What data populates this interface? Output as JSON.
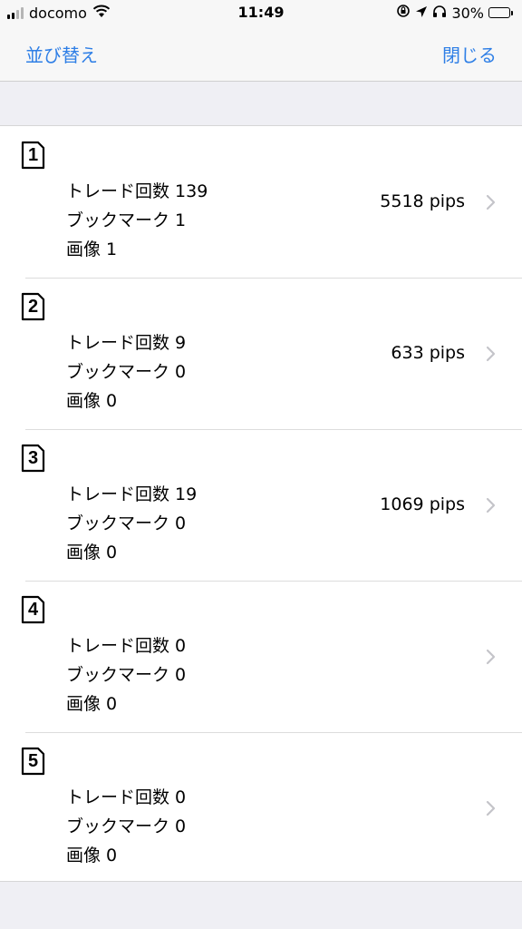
{
  "status_bar": {
    "carrier": "docomo",
    "time": "11:49",
    "battery_percent": "30%",
    "battery_level": 0.3,
    "signal_bars": 4,
    "signal_bars_active": 2,
    "icons": [
      "signal-icon",
      "wifi-icon",
      "orientation-lock-icon",
      "location-icon",
      "headphones-icon",
      "battery-icon"
    ]
  },
  "nav": {
    "left_label": "並び替え",
    "right_label": "閉じる",
    "accent_color": "#2f7fe6"
  },
  "rows": [
    {
      "number": "1",
      "trades": "トレード回数 139",
      "bookmarks": "ブックマーク 1",
      "images": "画像 1",
      "pips": "5518 pips"
    },
    {
      "number": "2",
      "trades": "トレード回数 9",
      "bookmarks": "ブックマーク 0",
      "images": "画像 0",
      "pips": "633 pips"
    },
    {
      "number": "3",
      "trades": "トレード回数 19",
      "bookmarks": "ブックマーク 0",
      "images": "画像 0",
      "pips": "1069 pips"
    },
    {
      "number": "4",
      "trades": "トレード回数 0",
      "bookmarks": "ブックマーク 0",
      "images": "画像 0",
      "pips": ""
    },
    {
      "number": "5",
      "trades": "トレード回数 0",
      "bookmarks": "ブックマーク 0",
      "images": "画像 0",
      "pips": ""
    }
  ]
}
